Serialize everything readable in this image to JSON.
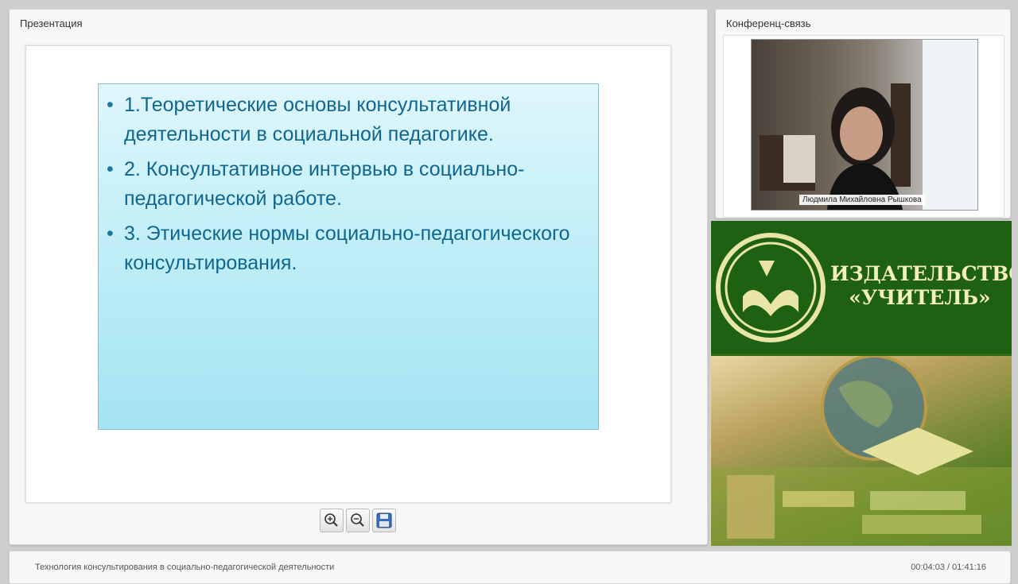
{
  "presentation": {
    "title": "Презентация",
    "slide": {
      "items": [
        "1.Теоретические основы консультативной деятельности в социальной педагогике.",
        "2. Консультативное интервью в социально-педагогической работе.",
        "3. Этические нормы социально-педагогического консультирования."
      ]
    },
    "toolbar": {
      "zoom_in_icon": "zoom-in-icon",
      "zoom_out_icon": "zoom-out-icon",
      "save_icon": "save-icon"
    }
  },
  "conference": {
    "title": "Конференц-связь",
    "speaker_name": "Людмила Михайловна Рышкова"
  },
  "promo": {
    "line1": "ИЗДАТЕЛЬСТВО",
    "line2": "«УЧИТЕЛЬ»"
  },
  "footer": {
    "course_title": "Технология консультирования в социально-педагогической деятельности",
    "time": "00:04:03 / 01:41:16"
  },
  "colors": {
    "slide_text": "#0f6690",
    "promo_green": "#1f6112",
    "promo_text": "#f5f0b8"
  }
}
